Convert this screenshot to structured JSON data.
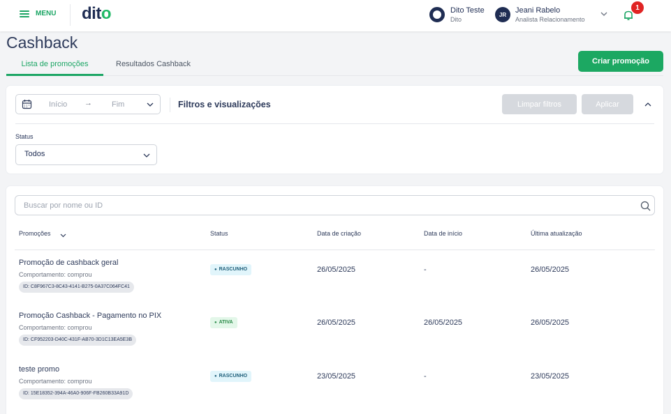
{
  "header": {
    "menu_label": "MENU",
    "logo_text": "dit",
    "logo_dot": "o",
    "account_name": "Dito Teste",
    "account_sub": "Dito",
    "user_initials": "JR",
    "user_name": "Jeani Rabelo",
    "user_role": "Analista Relacionamento",
    "notification_count": "1"
  },
  "page": {
    "title": "Cashback",
    "tabs": [
      {
        "label": "Lista de promoções",
        "active": true
      },
      {
        "label": "Resultados Cashback",
        "active": false
      }
    ],
    "create_button": "Criar promoção"
  },
  "filters": {
    "date_start_placeholder": "Início",
    "date_arrow": "→",
    "date_end_placeholder": "Fim",
    "title": "Filtros e visualizações",
    "clear_button": "Limpar filtros",
    "apply_button": "Aplicar",
    "status_label": "Status",
    "status_value": "Todos"
  },
  "table": {
    "search_placeholder": "Buscar por nome ou ID",
    "columns": [
      "Promoções",
      "Status",
      "Data de criação",
      "Data de início",
      "Última atualização"
    ],
    "rows": [
      {
        "name": "Promoção de cashback geral",
        "behavior": "Comportamento: comprou",
        "id": "ID: C8F967C3-8C43-4141-B275-0A37C064FC41",
        "status": "RASCUNHO",
        "status_kind": "draft",
        "created": "26/05/2025",
        "start": "-",
        "updated": "26/05/2025"
      },
      {
        "name": "Promoção Cashback - Pagamento no PIX",
        "behavior": "Comportamento: comprou",
        "id": "ID: CF952203-D40C-431F-AB70-3D1C13EA5E3B",
        "status": "ATIVA",
        "status_kind": "active",
        "created": "26/05/2025",
        "start": "26/05/2025",
        "updated": "26/05/2025"
      },
      {
        "name": "teste promo",
        "behavior": "Comportamento: comprou",
        "id": "ID: 15E18352-394A-46A0-906F-FB260B33A91D",
        "status": "RASCUNHO",
        "status_kind": "draft",
        "created": "23/05/2025",
        "start": "-",
        "updated": "23/05/2025"
      }
    ]
  },
  "colors": {
    "brand_green": "#1ca862",
    "navy": "#1f2d53",
    "alert_red": "#e02424"
  }
}
